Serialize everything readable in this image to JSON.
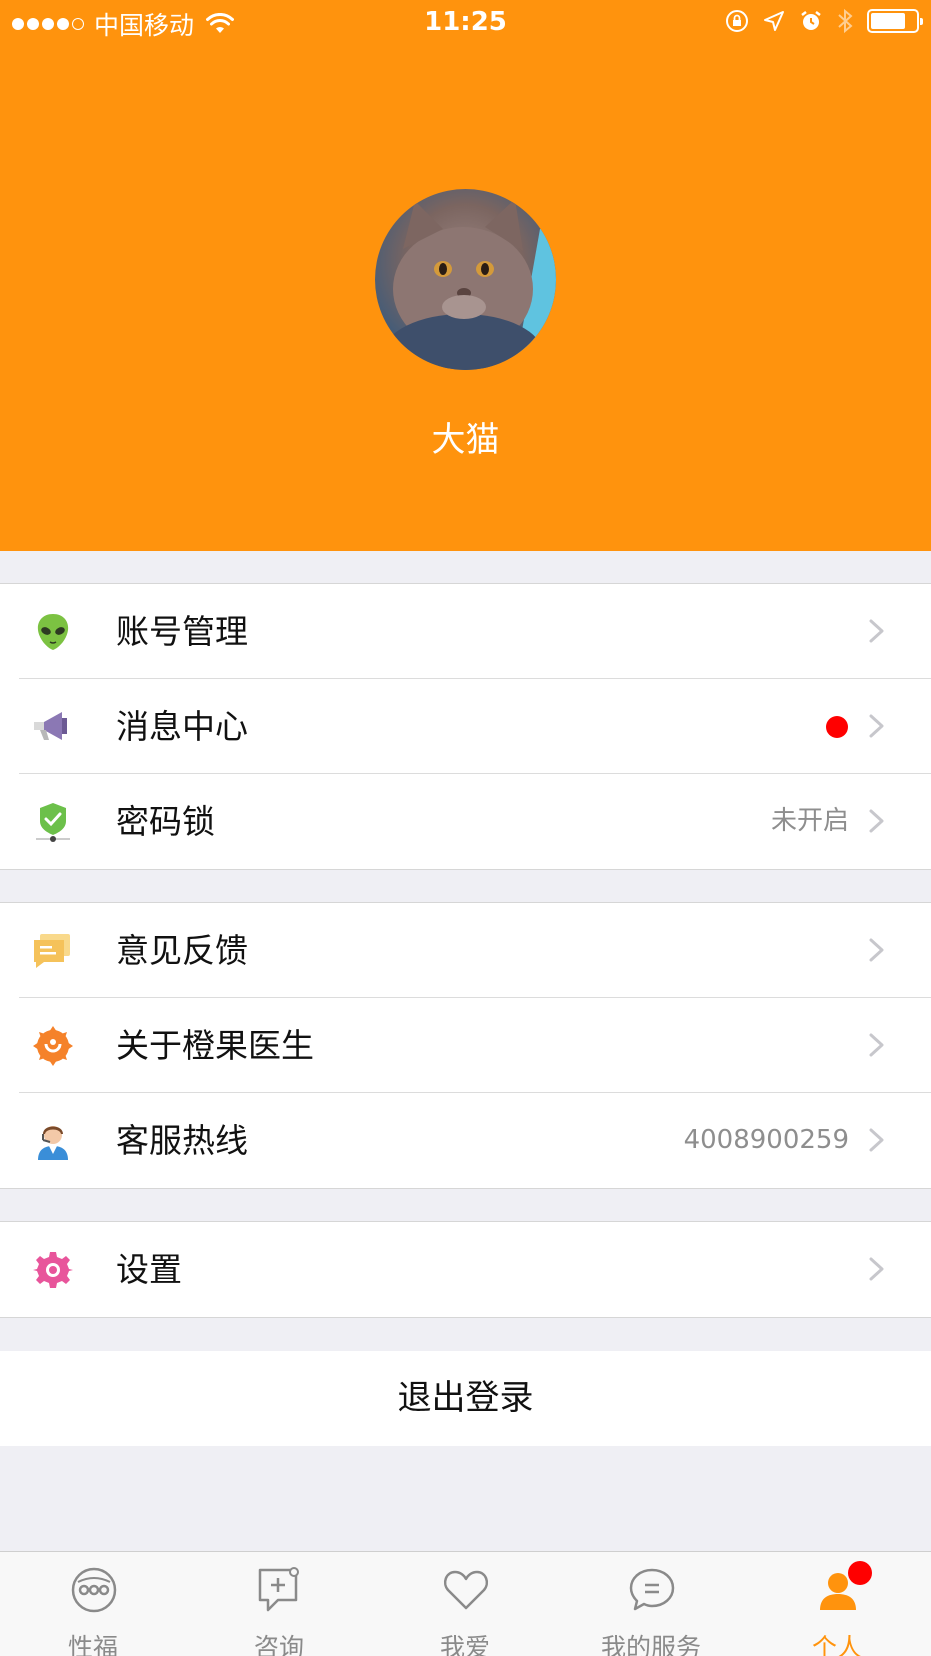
{
  "status_bar": {
    "carrier": "中国移动",
    "time": "11:25"
  },
  "profile": {
    "username": "大猫"
  },
  "menu": {
    "section1": [
      {
        "label": "账号管理",
        "value": "",
        "icon": "alien-icon",
        "badge": false
      },
      {
        "label": "消息中心",
        "value": "",
        "icon": "megaphone-icon",
        "badge": true
      },
      {
        "label": "密码锁",
        "value": "未开启",
        "icon": "shield-lock-icon",
        "badge": false
      }
    ],
    "section2": [
      {
        "label": "意见反馈",
        "value": "",
        "icon": "feedback-icon"
      },
      {
        "label": "关于橙果医生",
        "value": "",
        "icon": "orange-logo-icon"
      },
      {
        "label": "客服热线",
        "value": "4008900259",
        "icon": "customer-service-icon"
      }
    ],
    "section3": [
      {
        "label": "设置",
        "value": "",
        "icon": "gear-icon"
      }
    ]
  },
  "logout_label": "退出登录",
  "tabs": [
    {
      "label": "性福",
      "icon": "face-icon",
      "active": false
    },
    {
      "label": "咨询",
      "icon": "consult-icon",
      "active": false
    },
    {
      "label": "我爱",
      "icon": "heart-icon",
      "active": false
    },
    {
      "label": "我的服务",
      "icon": "chat-bubble-icon",
      "active": false
    },
    {
      "label": "个人",
      "icon": "person-icon",
      "active": true,
      "badge": true
    }
  ],
  "colors": {
    "accent": "#ff930d",
    "badge": "#ff0000"
  }
}
